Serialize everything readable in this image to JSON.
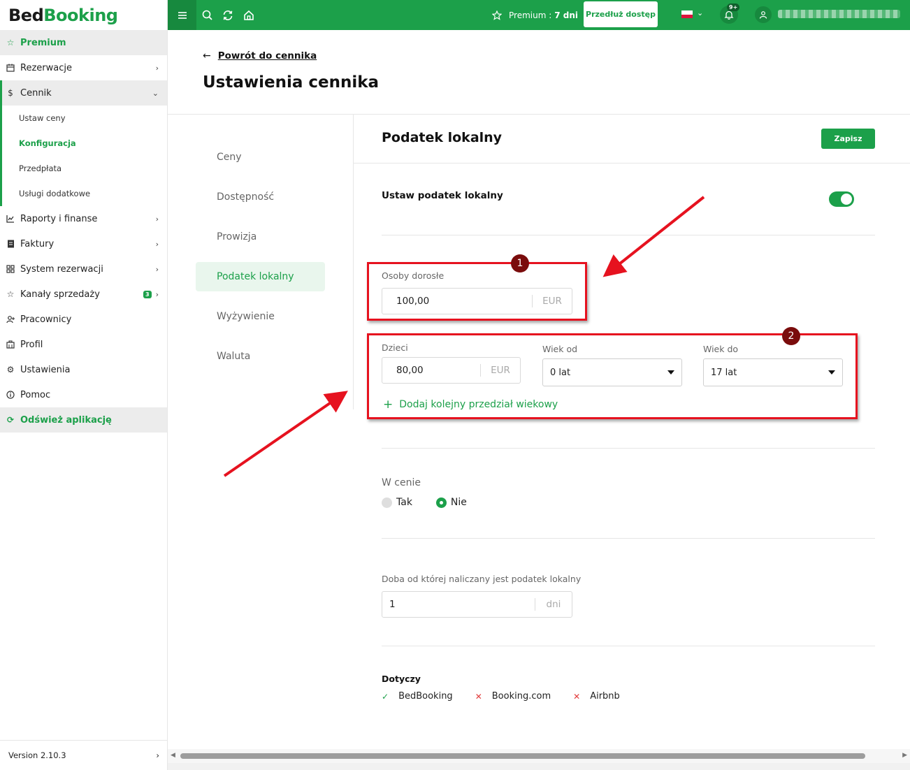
{
  "app": {
    "logo_part1": "Bed",
    "logo_part2": "Booking"
  },
  "sidebar": {
    "premium_label": "Premium",
    "items": [
      {
        "label": "Rezerwacje",
        "icon": "calendar-icon"
      },
      {
        "label": "Cennik",
        "icon": "dollar-icon"
      },
      {
        "label": "Raporty i finanse",
        "icon": "chart-icon"
      },
      {
        "label": "Faktury",
        "icon": "invoice-icon"
      },
      {
        "label": "System rezerwacji",
        "icon": "grid-icon"
      },
      {
        "label": "Kanały sprzedaży",
        "icon": "star-icon",
        "badge": "3"
      },
      {
        "label": "Pracownicy",
        "icon": "user-add-icon"
      },
      {
        "label": "Profil",
        "icon": "building-icon"
      },
      {
        "label": "Ustawienia",
        "icon": "gear-icon"
      },
      {
        "label": "Pomoc",
        "icon": "info-icon"
      }
    ],
    "submenu": [
      {
        "label": "Ustaw ceny"
      },
      {
        "label": "Konfiguracja"
      },
      {
        "label": "Przedpłata"
      },
      {
        "label": "Usługi dodatkowe"
      }
    ],
    "refresh_label": "Odśwież aplikację",
    "version": "Version 2.10.3"
  },
  "topbar": {
    "premium_text": "Premium :",
    "premium_days": "7 dni",
    "extend_button": "Przedłuż dostęp",
    "notifications_badge": "9+",
    "accent_color": "#1ca04a"
  },
  "page": {
    "back_link": "Powrót do cennika",
    "title": "Ustawienia cennika"
  },
  "settings_nav": [
    {
      "label": "Ceny"
    },
    {
      "label": "Dostępność"
    },
    {
      "label": "Prowizja"
    },
    {
      "label": "Podatek lokalny"
    },
    {
      "label": "Wyżywienie"
    },
    {
      "label": "Waluta"
    }
  ],
  "panel": {
    "title": "Podatek lokalny",
    "save_button": "Zapisz",
    "toggle_label": "Ustaw podatek lokalny",
    "toggle_on": true,
    "adults": {
      "label": "Osoby dorosłe",
      "value": "100,00",
      "unit": "EUR"
    },
    "children": {
      "label": "Dzieci",
      "value": "80,00",
      "unit": "EUR"
    },
    "age_from": {
      "label": "Wiek od",
      "value": "0 lat"
    },
    "age_to": {
      "label": "Wiek do",
      "value": "17 lat"
    },
    "add_age_range": "Dodaj kolejny przedział wiekowy",
    "included": {
      "label": "W cenie",
      "option_yes": "Tak",
      "option_no": "Nie",
      "selected": "Nie"
    },
    "night_from": {
      "label": "Doba od której naliczany jest podatek lokalny",
      "value": "1",
      "unit": "dni"
    },
    "applies_to": {
      "label": "Dotyczy",
      "channels": [
        {
          "name": "BedBooking",
          "enabled": true
        },
        {
          "name": "Booking.com",
          "enabled": false
        },
        {
          "name": "Airbnb",
          "enabled": false
        }
      ]
    }
  },
  "annotations": {
    "marker_1": "1",
    "marker_2": "2",
    "color": "#e6121f"
  }
}
